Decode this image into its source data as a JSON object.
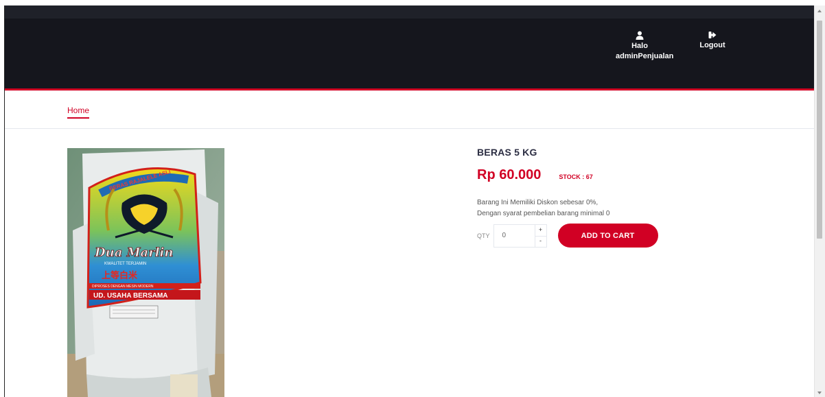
{
  "header": {
    "user_greeting": "Halo",
    "username": "adminPenjualan",
    "logout_label": "Logout"
  },
  "breadcrumb": {
    "home_label": "Home"
  },
  "product": {
    "name": "BERAS 5 KG",
    "price": "Rp 60.000",
    "stock": "STOCK : 67",
    "description_line1": "Barang Ini Memiliki Diskon sebesar 0%,",
    "description_line2": "Dengan syarat pembelian barang minimal 0",
    "image_label": "Beras Rajalele Asli Dua Marlin",
    "bag_text": {
      "top_arc": "BERAS RAJALELE ASLI",
      "brand": "Dua Marlin",
      "quality": "KWALITET TERJAMIN",
      "cjk": "上等白米",
      "sub": "DIPROSES DENGAN MESIN MODERN",
      "maker": "UD. USAHA BERSAMA"
    }
  },
  "cart": {
    "qty_label": "QTY",
    "qty_value": "0",
    "plus": "+",
    "minus": "-",
    "add_label": "ADD TO CART"
  },
  "colors": {
    "accent": "#D10024",
    "header_bg": "#15161D",
    "title": "#2B2D42"
  }
}
